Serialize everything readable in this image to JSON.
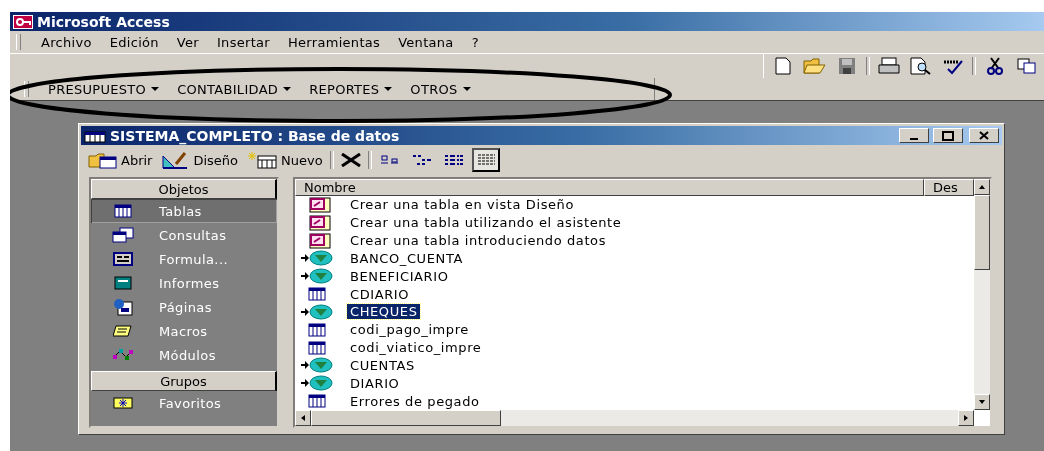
{
  "window": {
    "title": "Microsoft Access"
  },
  "menu": [
    "Archivo",
    "Edición",
    "Ver",
    "Insertar",
    "Herramientas",
    "Ventana",
    "?"
  ],
  "custom_toolbar": [
    "PRESUPUESTO",
    "CONTABILIDAD",
    "REPORTES",
    "OTROS"
  ],
  "database_window": {
    "title": "SISTEMA_COMPLETO : Base de datos",
    "toolbar": [
      {
        "label": "Abrir",
        "kind": "open"
      },
      {
        "label": "Diseño",
        "kind": "design"
      },
      {
        "label": "Nuevo",
        "kind": "new"
      }
    ],
    "view_modes": [
      {
        "kind": "large",
        "selected": false
      },
      {
        "kind": "small",
        "selected": false
      },
      {
        "kind": "list",
        "selected": false
      },
      {
        "kind": "details",
        "selected": true
      }
    ],
    "objects_header": "Objetos",
    "objects": [
      {
        "label": "Tablas",
        "kind": "table",
        "selected": true
      },
      {
        "label": "Consultas",
        "kind": "query",
        "selected": false
      },
      {
        "label": "Formula...",
        "kind": "form",
        "selected": false
      },
      {
        "label": "Informes",
        "kind": "report",
        "selected": false
      },
      {
        "label": "Páginas",
        "kind": "page",
        "selected": false
      },
      {
        "label": "Macros",
        "kind": "macro",
        "selected": false
      },
      {
        "label": "Módulos",
        "kind": "module",
        "selected": false
      }
    ],
    "groups_header": "Grupos",
    "groups": [
      {
        "label": "Favoritos"
      }
    ],
    "columns": [
      "Nombre",
      "Des"
    ],
    "rows": [
      {
        "name": "Crear una tabla en vista Diseño",
        "kind": "shortcut",
        "selected": false
      },
      {
        "name": "Crear una tabla utilizando el asistente",
        "kind": "shortcut",
        "selected": false
      },
      {
        "name": "Crear una tabla introduciendo datos",
        "kind": "shortcut",
        "selected": false
      },
      {
        "name": "BANCO_CUENTA",
        "kind": "linked",
        "selected": false
      },
      {
        "name": "BENEFICIARIO",
        "kind": "linked",
        "selected": false
      },
      {
        "name": "CDIARIO",
        "kind": "table",
        "selected": false
      },
      {
        "name": "CHEQUES",
        "kind": "linked",
        "selected": true
      },
      {
        "name": "codi_pago_impre",
        "kind": "table",
        "selected": false
      },
      {
        "name": "codi_viatico_impre",
        "kind": "table",
        "selected": false
      },
      {
        "name": "CUENTAS",
        "kind": "linked",
        "selected": false
      },
      {
        "name": "DIARIO",
        "kind": "linked",
        "selected": false
      },
      {
        "name": "Errores de pegado",
        "kind": "table",
        "selected": false
      }
    ]
  }
}
